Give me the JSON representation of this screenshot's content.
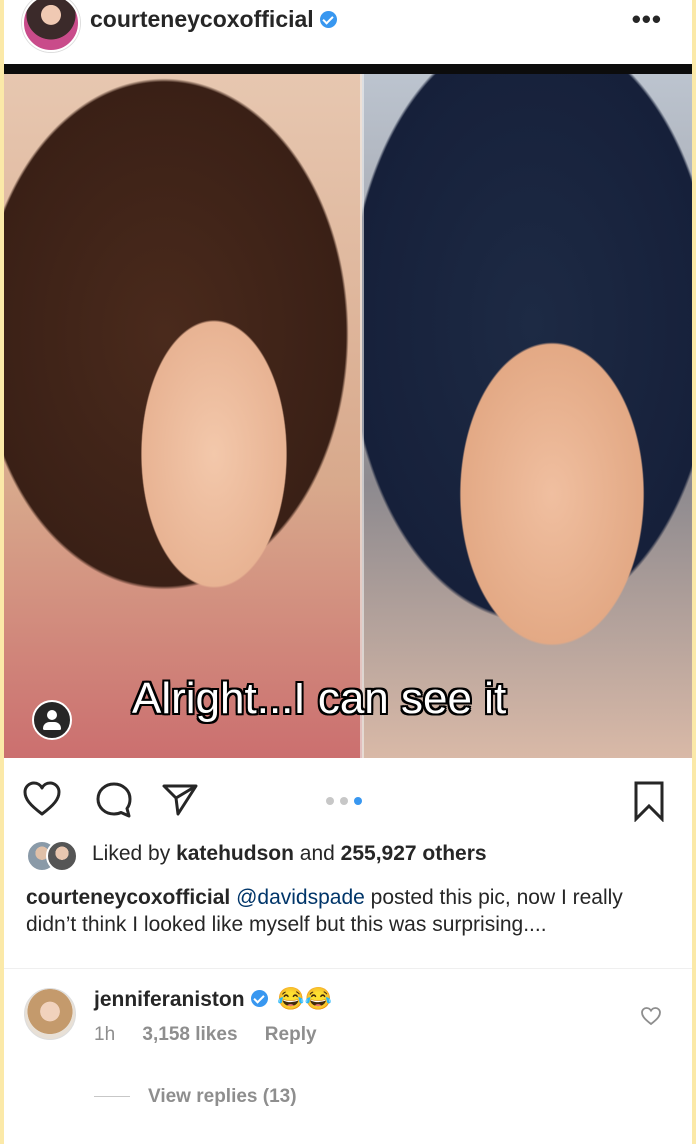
{
  "post": {
    "username": "courteneycoxofficial",
    "verified_icon": "verified-badge-icon",
    "more_icon": "ellipsis-icon",
    "photo_caption_text": "Alright...I can see it",
    "carousel": {
      "total": 3,
      "active_index": 2
    }
  },
  "actions": {
    "like_icon": "heart-icon",
    "comment_icon": "comment-bubble-icon",
    "share_icon": "paper-plane-icon",
    "save_icon": "bookmark-icon"
  },
  "likes": {
    "prefix": "Liked by",
    "user": "katehudson",
    "and": "and",
    "others": "255,927 others"
  },
  "caption": {
    "username": "courteneycoxofficial",
    "mention": "@davidspade",
    "text": "posted this pic, now I really didn’t think I looked like myself but this was surprising...."
  },
  "comment": {
    "username": "jenniferaniston",
    "emojis": "😂😂",
    "time": "1h",
    "likes": "3,158 likes",
    "reply": "Reply",
    "heart_icon": "heart-outline-icon"
  },
  "view_replies": "View replies (13)",
  "colors": {
    "accent_blue": "#3897f0",
    "mention_blue": "#003569",
    "muted_gray": "#8e8e8e",
    "text": "#262626",
    "page_edge": "#fbe9a8"
  }
}
